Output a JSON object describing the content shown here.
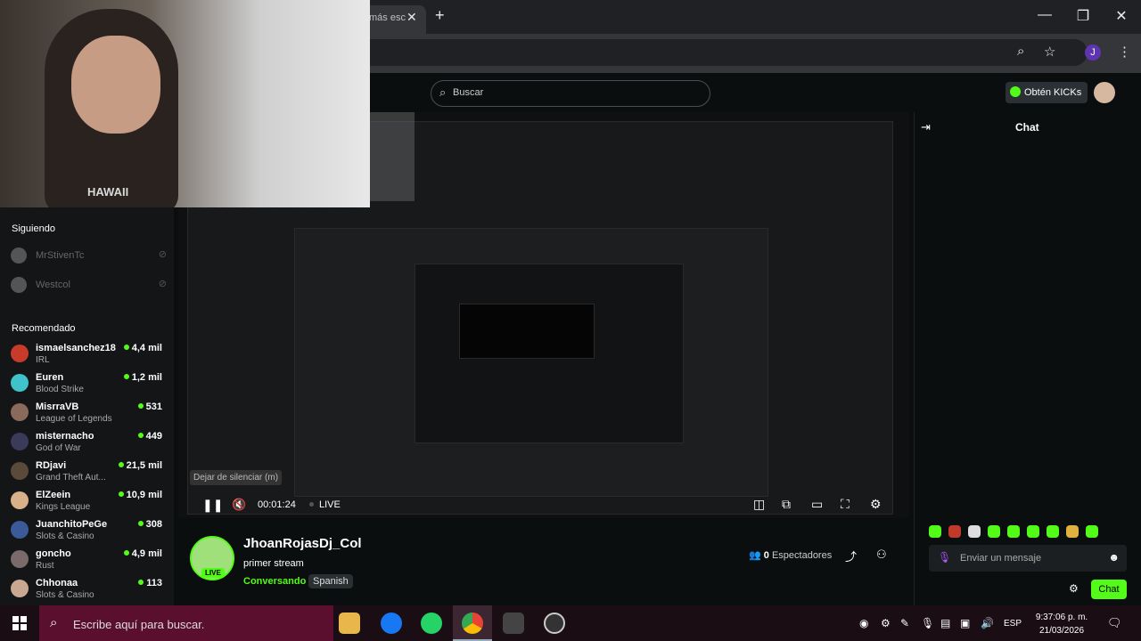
{
  "browser": {
    "tab_title": "más esc",
    "tab_close": "✕",
    "new_tab": "+",
    "win_min": "—",
    "win_max": "❐",
    "win_close": "✕",
    "zoom_icon": "⌕",
    "star_icon": "☆",
    "profile_initial": "J",
    "menu_icon": "⋮"
  },
  "header": {
    "search_placeholder": "Buscar",
    "kicks_label": "Obtén KICKs"
  },
  "webcam": {
    "shirt_text": "HAWAII"
  },
  "sidebar": {
    "following_heading": "Siguiendo",
    "following": [
      {
        "name": "MrStivenTc"
      },
      {
        "name": "Westcol"
      }
    ],
    "recommended_heading": "Recomendado",
    "recommended": [
      {
        "name": "ismaelsanchez18",
        "category": "IRL",
        "viewers": "4,4 mil"
      },
      {
        "name": "Euren",
        "category": "Blood Strike",
        "viewers": "1,2 mil"
      },
      {
        "name": "MisrraVB",
        "category": "League of Legends",
        "viewers": "531"
      },
      {
        "name": "misternacho",
        "category": "God of War",
        "viewers": "449"
      },
      {
        "name": "RDjavi",
        "category": "Grand Theft Aut...",
        "viewers": "21,5 mil"
      },
      {
        "name": "ElZeein",
        "category": "Kings League",
        "viewers": "10,9 mil"
      },
      {
        "name": "JuanchitoPeGe",
        "category": "Slots & Casino",
        "viewers": "308"
      },
      {
        "name": "goncho",
        "category": "Rust",
        "viewers": "4,9 mil"
      },
      {
        "name": "Chhonaa",
        "category": "Slots & Casino",
        "viewers": "113"
      }
    ]
  },
  "player": {
    "tooltip": "Dejar de silenciar (m)",
    "time": "00:01:24",
    "live_label": "LIVE"
  },
  "stream": {
    "streamer_name": "JhoanRojasDj_Col",
    "live_badge": "LIVE",
    "title": "primer stream",
    "category": "Conversando",
    "language": "Spanish",
    "viewers_count": "0",
    "viewers_label": "Espectadores"
  },
  "chat": {
    "title": "Chat",
    "input_placeholder": "Enviar un mensaje",
    "send_label": "Chat"
  },
  "taskbar": {
    "search_placeholder": "Escribe aquí para buscar.",
    "language": "ESP",
    "time": "9:37:06 p. m.",
    "date": "21/03/2026"
  },
  "colors": {
    "accent": "#53fc18",
    "taskbar_search": "#5a0f2f"
  }
}
